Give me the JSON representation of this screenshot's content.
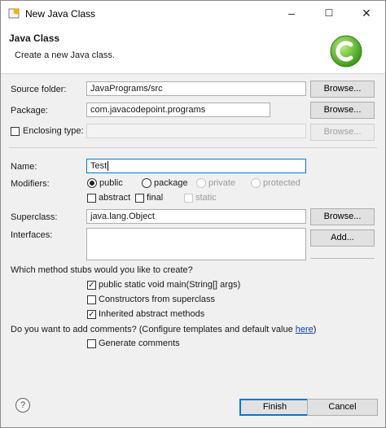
{
  "window": {
    "title": "New Java Class",
    "minimize": "–",
    "maximize": "☐",
    "close": "✕"
  },
  "header": {
    "title": "Java Class",
    "subtitle": "Create a new Java class."
  },
  "source_folder": {
    "label": "Source folder:",
    "value": "JavaPrograms/src",
    "browse": "Browse..."
  },
  "package": {
    "label": "Package:",
    "value": "com.javacodepoint.programs",
    "browse": "Browse..."
  },
  "enclosing_type": {
    "label": "Enclosing type:",
    "value": "",
    "browse": "Browse...",
    "checked": false
  },
  "name": {
    "label": "Name:",
    "value": "Test"
  },
  "modifiers": {
    "label": "Modifiers:",
    "public": "public",
    "package": "package",
    "private": "private",
    "protected": "protected",
    "abstract": "abstract",
    "final": "final",
    "static": "static",
    "selected": "public"
  },
  "superclass": {
    "label": "Superclass:",
    "value": "java.lang.Object",
    "browse": "Browse..."
  },
  "interfaces": {
    "label": "Interfaces:",
    "add": "Add..."
  },
  "stubs": {
    "question": "Which method stubs would you like to create?",
    "main": "public static void main(String[] args)",
    "constructors": "Constructors from superclass",
    "inherited": "Inherited abstract methods"
  },
  "comments": {
    "question": "Do you want to add comments? (Configure templates and default value ",
    "link": "here",
    "close_paren": ")",
    "generate": "Generate comments"
  },
  "footer": {
    "help": "?",
    "finish": "Finish",
    "cancel": "Cancel"
  },
  "colors": {
    "accent": "#0078d7",
    "logo": "#5cb82e"
  }
}
